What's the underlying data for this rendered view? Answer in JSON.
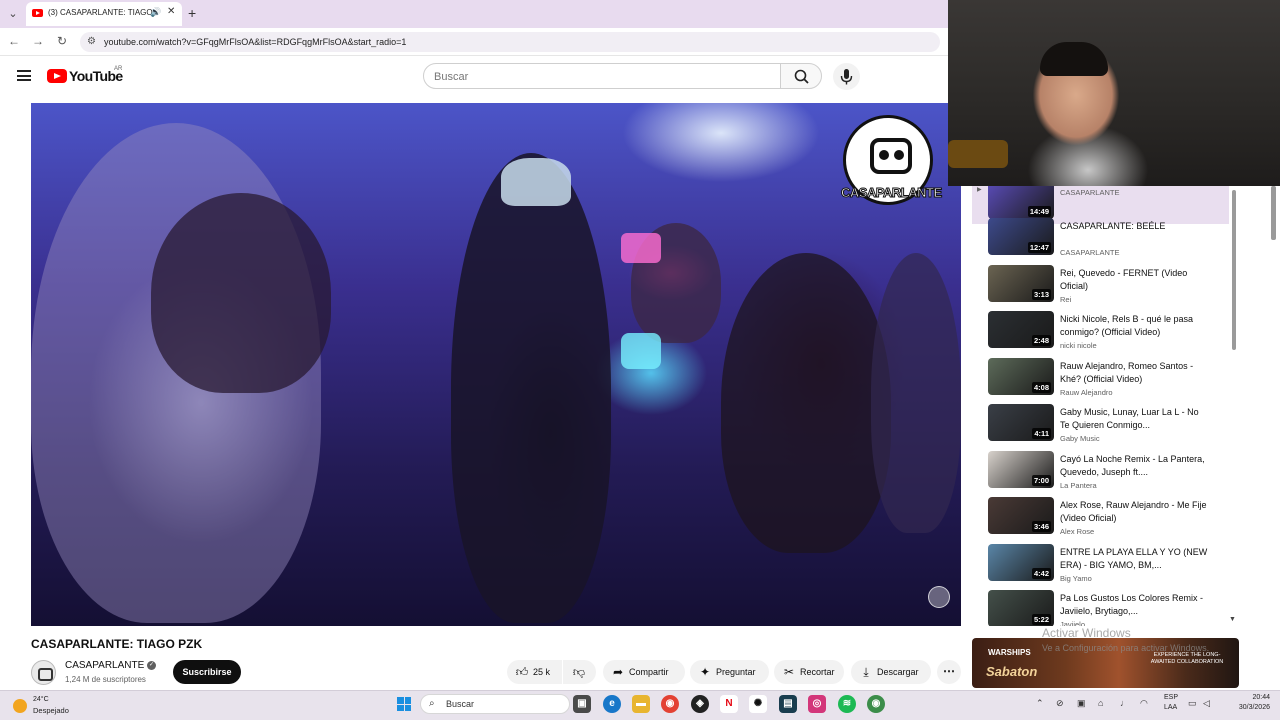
{
  "browser": {
    "tab_title": "(3) CASAPARLANTE: TIAGO",
    "url": "youtube.com/watch?v=GFqgMrFlsOA&list=RDGFqgMrFlsOA&start_radio=1"
  },
  "header": {
    "logo": "YouTube",
    "country": "AR",
    "search_placeholder": "Buscar"
  },
  "video": {
    "title": "CASAPARLANTE: TIAGO PZK",
    "overlay_logo_text": "CASAPARLANTE",
    "channel": "CASAPARLANTE",
    "subscribers": "1,24 M de suscriptores",
    "subscribe_label": "Suscribirse",
    "likes": "25 k",
    "actions": {
      "share": "Compartir",
      "ask": "Preguntar",
      "clip": "Recortar",
      "download": "Descargar"
    }
  },
  "playlist": [
    {
      "title": "",
      "channel": "CASAPARLANTE",
      "duration": "14:49",
      "active": true,
      "thumb": "#5a4cb8"
    },
    {
      "title": "CASAPARLANTE: BEÉLE",
      "channel": "CASAPARLANTE",
      "duration": "12:47",
      "thumb": "#3d4a8c"
    },
    {
      "title": "Rei, Quevedo - FERNET (Video Oficial)",
      "channel": "Rei",
      "duration": "3:13",
      "thumb": "#6b6452"
    },
    {
      "title": "Nicki Nicole, Rels B - qué le pasa conmigo? (Official Video)",
      "channel": "nicki nicole",
      "duration": "2:48",
      "thumb": "#2b2f33"
    },
    {
      "title": "Rauw Alejandro, Romeo Santos - Khé? (Official Video)",
      "channel": "Rauw Alejandro",
      "duration": "4:08",
      "thumb": "#5d6b5a"
    },
    {
      "title": "Gaby Music, Lunay, Luar La L - No Te Quieren Conmigo...",
      "channel": "Gaby Music",
      "duration": "4:11",
      "thumb": "#3a3f47"
    },
    {
      "title": "Cayó La Noche Remix - La Pantera, Quevedo, Juseph ft....",
      "channel": "La Pantera",
      "duration": "7:00",
      "thumb": "#d8d2cc"
    },
    {
      "title": "Alex Rose, Rauw Alejandro - Me Fije (Video Oficial)",
      "channel": "Alex Rose",
      "duration": "3:46",
      "thumb": "#4a3a36"
    },
    {
      "title": "ENTRE LA PLAYA ELLA Y YO (NEW ERA) - BIG YAMO, BM,...",
      "channel": "Big Yamo",
      "duration": "4:42",
      "thumb": "#5a86a8"
    },
    {
      "title": "Pa Los Gustos Los Colores Remix - Javiielo, Brytiago,...",
      "channel": "Javiielo",
      "duration": "5:22",
      "thumb": "#44504a"
    }
  ],
  "ad": {
    "line1": "WARSHIPS",
    "line2": "Sabaton",
    "right_text": "EXPERIENCE THE LONG-AWAITED COLLABORATION"
  },
  "watermark": {
    "line1": "Activar Windows",
    "line2": "Ve a Configuración para activar Windows."
  },
  "taskbar": {
    "temperature": "24°C",
    "weather": "Despejado",
    "search_label": "Buscar",
    "lang1": "ESP",
    "lang2": "LAA",
    "time": "20:44",
    "date": "30/3/2026"
  },
  "colors": {
    "youtube_red": "#ff0000",
    "subscribe_bg": "#0f0f0f",
    "playlist_active": "#e9deef",
    "tabbar": "#e8dbef"
  }
}
